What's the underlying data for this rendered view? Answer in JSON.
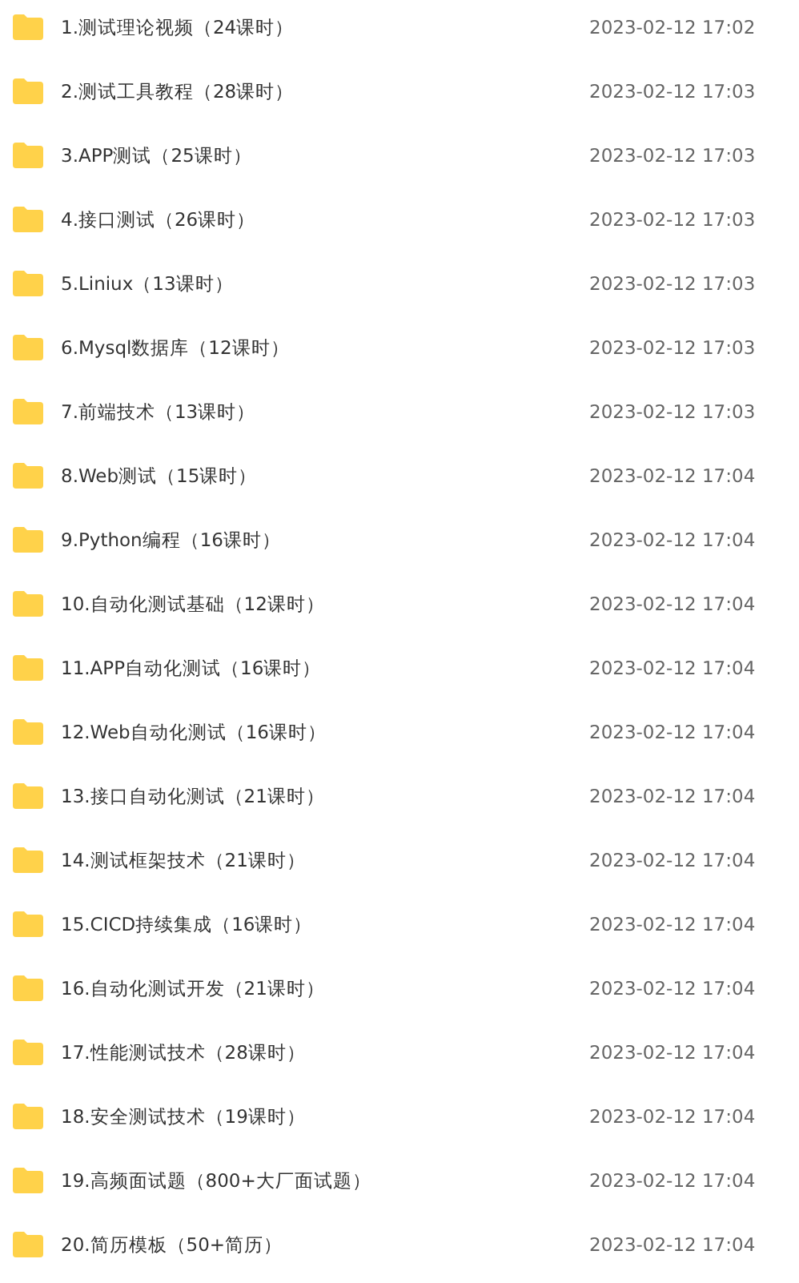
{
  "files": [
    {
      "name": "1.测试理论视频（24课时）",
      "date": "2023-02-12 17:02"
    },
    {
      "name": "2.测试工具教程（28课时）",
      "date": "2023-02-12 17:03"
    },
    {
      "name": "3.APP测试（25课时）",
      "date": "2023-02-12 17:03"
    },
    {
      "name": "4.接口测试（26课时）",
      "date": "2023-02-12 17:03"
    },
    {
      "name": "5.Liniux（13课时）",
      "date": "2023-02-12 17:03"
    },
    {
      "name": "6.Mysql数据库（12课时）",
      "date": "2023-02-12 17:03"
    },
    {
      "name": "7.前端技术（13课时）",
      "date": "2023-02-12 17:03"
    },
    {
      "name": "8.Web测试（15课时）",
      "date": "2023-02-12 17:04"
    },
    {
      "name": "9.Python编程（16课时）",
      "date": "2023-02-12 17:04"
    },
    {
      "name": "10.自动化测试基础（12课时）",
      "date": "2023-02-12 17:04"
    },
    {
      "name": "11.APP自动化测试（16课时）",
      "date": "2023-02-12 17:04"
    },
    {
      "name": "12.Web自动化测试（16课时）",
      "date": "2023-02-12 17:04"
    },
    {
      "name": "13.接口自动化测试（21课时）",
      "date": "2023-02-12 17:04"
    },
    {
      "name": "14.测试框架技术（21课时）",
      "date": "2023-02-12 17:04"
    },
    {
      "name": "15.CICD持续集成（16课时）",
      "date": "2023-02-12 17:04"
    },
    {
      "name": "16.自动化测试开发（21课时）",
      "date": "2023-02-12 17:04"
    },
    {
      "name": "17.性能测试技术（28课时）",
      "date": "2023-02-12 17:04"
    },
    {
      "name": "18.安全测试技术（19课时）",
      "date": "2023-02-12 17:04"
    },
    {
      "name": "19.高频面试题（800+大厂面试题）",
      "date": "2023-02-12 17:04"
    },
    {
      "name": "20.简历模板（50+简历）",
      "date": "2023-02-12 17:04"
    }
  ]
}
